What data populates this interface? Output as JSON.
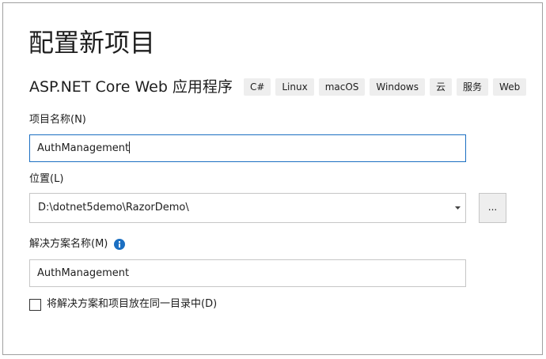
{
  "page": {
    "title": "配置新项目"
  },
  "template": {
    "name": "ASP.NET Core Web 应用程序",
    "tags": [
      "C#",
      "Linux",
      "macOS",
      "Windows",
      "云",
      "服务",
      "Web"
    ]
  },
  "project_name": {
    "label": "项目名称(N)",
    "value": "AuthManagement"
  },
  "location": {
    "label": "位置(L)",
    "value": "D:\\dotnet5demo\\RazorDemo\\",
    "browse_label": "..."
  },
  "solution_name": {
    "label": "解决方案名称(M)",
    "value": "AuthManagement",
    "info_icon": "info-icon"
  },
  "same_directory": {
    "label": "将解决方案和项目放在同一目录中(D)",
    "checked": false
  },
  "colors": {
    "focus_border": "#1b6fc2",
    "info_icon": "#1b6fc2",
    "tag_background": "#eeeeee"
  }
}
